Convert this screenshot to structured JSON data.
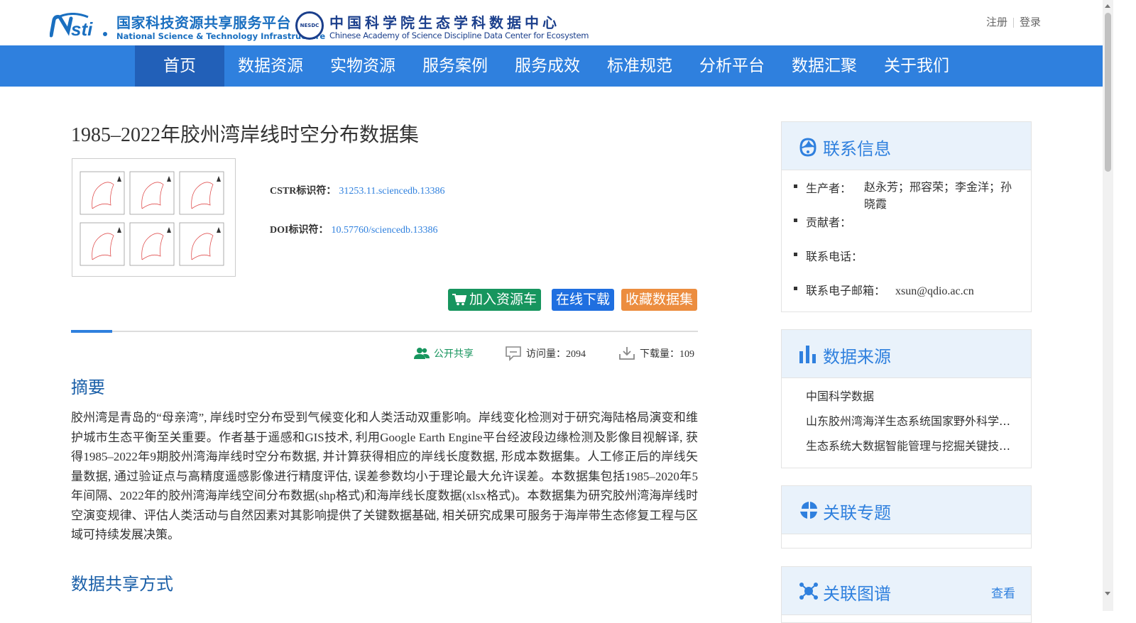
{
  "header": {
    "logo1_cn": "国家科技资源共享服务平台",
    "logo1_en": "National Science & Technology Infrastructure",
    "logo2_badge": "NESDC",
    "logo2_cn": "中国科学院生态学科数据中心",
    "logo2_en": "Chinese Academy of Science Discipline Data Center for Ecosystem",
    "register": "注册",
    "login": "登录"
  },
  "nav": {
    "items": [
      "首页",
      "数据资源",
      "实物资源",
      "服务案例",
      "服务成效",
      "标准规范",
      "分析平台",
      "数据汇聚",
      "关于我们"
    ],
    "active": "首页"
  },
  "dataset": {
    "title": "1985–2022年胶州湾岸线时空分布数据集",
    "cstr_label": "CSTR标识符：",
    "cstr": "31253.11.sciencedb.13386",
    "doi_label": "DOI标识符：",
    "doi": "10.57760/sciencedb.13386"
  },
  "actions": {
    "cart": "加入资源车",
    "download": "在线下载",
    "favorite": "收藏数据集"
  },
  "stats": {
    "share": "公开共享",
    "visits": "访问量：2094",
    "downloads": "下载量：109"
  },
  "abstract": {
    "heading": "摘要",
    "text": "胶州湾是青岛的“母亲湾”, 岸线时空分布受到气候变化和人类活动双重影响。岸线变化检测对于研究海陆格局演变和维护城市生态平衡至关重要。作者基于遥感和GIS技术, 利用Google Earth Engine平台经波段边缘检测及影像目视解译, 获得1985–2022年9期胶州湾海岸线时空分布数据, 并计算获得相应的岸线长度数据, 形成本数据集。人工修正后的岸线矢量数据, 通过验证点与高精度遥感影像进行精度评估, 误差参数均小于理论最大允许误差。本数据集包括1985–2020年5年间隔、2022年的胶州湾海岸线空间分布数据(shp格式)和海岸线长度数据(xlsx格式)。本数据集为研究胶州湾海岸线时空演变规律、评估人类活动与自然因素对其影响提供了关键数据基础, 相关研究成果可服务于海岸带生态修复工程与区域可持续发展决策。"
  },
  "sharing": {
    "heading": "数据共享方式"
  },
  "contact": {
    "title": "联系信息",
    "producer_label": "生产者：",
    "producer": "赵永芳；邢容荣；李金洋；孙晓霞",
    "contributor_label": "贡献者：",
    "phone_label": "联系电话：",
    "email_label": "联系电子邮箱：",
    "email": "xsun@qdio.ac.cn"
  },
  "source": {
    "title": "数据来源",
    "items": [
      "中国科学数据",
      "山东胶州湾海洋生态系统国家野外科学观测研究站",
      "生态系统大数据智能管理与挖掘关键技术研究"
    ]
  },
  "topics": {
    "title": "关联专题"
  },
  "graph": {
    "title": "关联图谱",
    "more": "查看"
  },
  "colors": {
    "nav": "#2f80de",
    "nav_active": "#2260b8",
    "cart": "#17955e",
    "download": "#1f6fe0",
    "favorite": "#ec8d3f",
    "heading": "#1a5fa8",
    "panel_title": "#2f80de"
  }
}
